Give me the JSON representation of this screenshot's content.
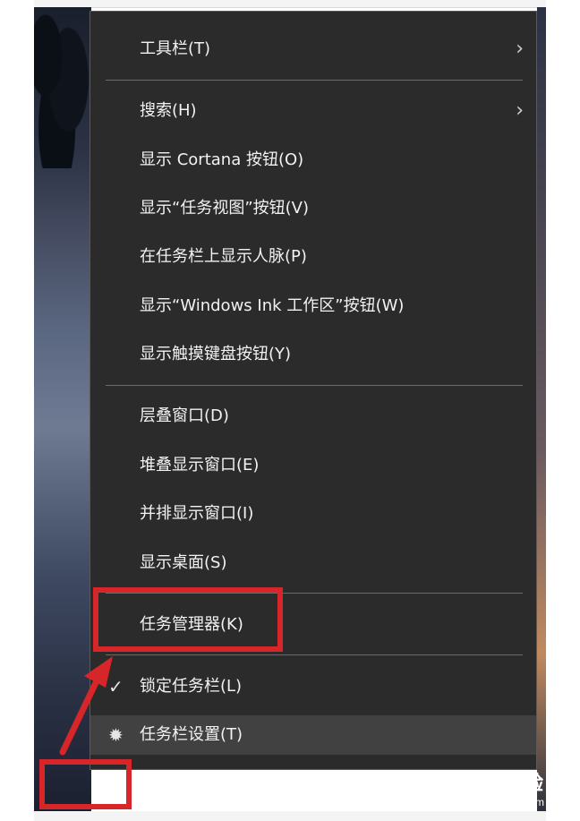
{
  "menu": {
    "items": [
      {
        "label": "工具栏(T)",
        "submenu": true
      },
      {
        "label": "搜索(H)",
        "submenu": true
      },
      {
        "label": "显示 Cortana 按钮(O)"
      },
      {
        "label": "显示“任务视图”按钮(V)"
      },
      {
        "label": "在任务栏上显示人脉(P)"
      },
      {
        "label": "显示“Windows Ink 工作区”按钮(W)"
      },
      {
        "label": "显示触摸键盘按钮(Y)"
      },
      {
        "label": "层叠窗口(D)"
      },
      {
        "label": "堆叠显示窗口(E)"
      },
      {
        "label": "并排显示窗口(I)"
      },
      {
        "label": "显示桌面(S)"
      },
      {
        "label": "任务管理器(K)"
      },
      {
        "label": "锁定任务栏(L)",
        "checked": true
      },
      {
        "label": "任务栏设置(T)",
        "icon": "gear-icon"
      }
    ],
    "submenu_arrow": "›",
    "check_glyph": "✓",
    "gear_glyph": "✹"
  },
  "watermark": {
    "brand": "Bai du 经验",
    "url": "jingyan.baidu.com"
  },
  "colors": {
    "menu_bg": "#2b2b2b",
    "highlight": "#414141",
    "annotation_red": "#d6262a",
    "text": "#f2f2f2"
  }
}
